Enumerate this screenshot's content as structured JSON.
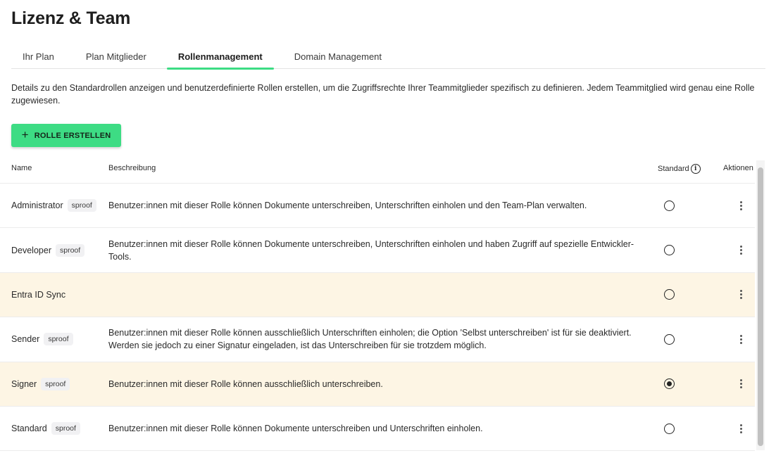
{
  "page": {
    "title": "Lizenz & Team"
  },
  "tabs": [
    {
      "label": "Ihr Plan",
      "active": false
    },
    {
      "label": "Plan Mitglieder",
      "active": false
    },
    {
      "label": "Rollenmanagement",
      "active": true
    },
    {
      "label": "Domain Management",
      "active": false
    }
  ],
  "intro": "Details zu den Standardrollen anzeigen und benutzerdefinierte Rollen erstellen, um die Zugriffsrechte Ihrer Teammitglieder spezifisch zu definieren. Jedem Teammitglied wird genau eine Rolle zugewiesen.",
  "create_button": {
    "label": "ROLLE ERSTELLEN",
    "icon": "plus-icon"
  },
  "table": {
    "headers": {
      "name": "Name",
      "description": "Beschreibung",
      "standard": "Standard",
      "actions": "Aktionen"
    },
    "rows": [
      {
        "name": "Administrator",
        "badge": "sproof",
        "description": "Benutzer:innen mit dieser Rolle können Dokumente unterschreiben, Unterschriften einholen und den Team-Plan verwalten.",
        "standard": false,
        "highlight": false
      },
      {
        "name": "Developer",
        "badge": "sproof",
        "description": "Benutzer:innen mit dieser Rolle können Dokumente unterschreiben, Unterschriften einholen und haben Zugriff auf spezielle Entwickler-Tools.",
        "standard": false,
        "highlight": false
      },
      {
        "name": "Entra ID Sync",
        "badge": "",
        "description": "",
        "standard": false,
        "highlight": true
      },
      {
        "name": "Sender",
        "badge": "sproof",
        "description": "Benutzer:innen mit dieser Rolle können ausschließlich Unterschriften einholen; die Option 'Selbst unterschreiben' ist für sie deaktiviert. Werden sie jedoch zu einer Signatur eingeladen, ist das Unterschreiben für sie trotzdem möglich.",
        "standard": false,
        "highlight": false
      },
      {
        "name": "Signer",
        "badge": "sproof",
        "description": "Benutzer:innen mit dieser Rolle können ausschließlich unterschreiben.",
        "standard": true,
        "highlight": true
      },
      {
        "name": "Standard",
        "badge": "sproof",
        "description": "Benutzer:innen mit dieser Rolle können Dokumente unterschreiben und Unterschriften einholen.",
        "standard": false,
        "highlight": false
      }
    ]
  },
  "colors": {
    "accent": "#3ddc84",
    "highlight_row": "#fdf5e4",
    "badge_bg": "#f1f1f3"
  }
}
